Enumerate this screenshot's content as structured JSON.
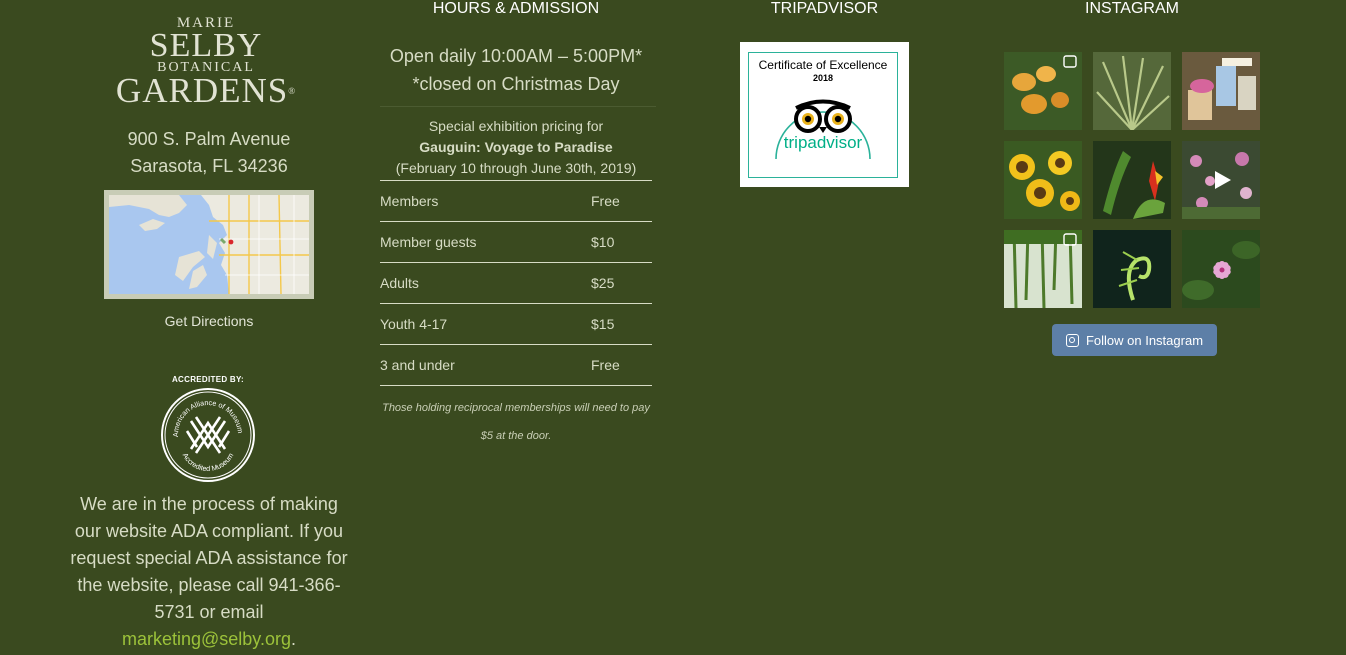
{
  "logo": {
    "line1": "MARIE",
    "line2": "SELBY",
    "line3": "BOTANICAL",
    "line4": "GARDENS",
    "reg": "®"
  },
  "address": {
    "street": "900 S. Palm Avenue",
    "city": "Sarasota, FL 34236"
  },
  "directions_label": "Get Directions",
  "accreditation": {
    "label": "ACCREDITED BY:",
    "seal_top": "American Alliance of Museums",
    "seal_bottom": "Accredited Museum"
  },
  "ada": {
    "text": "We are in the process of making our website ADA compliant. If you request special ADA assistance for the website, please call 941-366-5731 or email",
    "email": "marketing@selby.org",
    "end": "."
  },
  "hours": {
    "title": "HOURS & ADMISSION",
    "line1": "Open daily 10:00AM – 5:00PM*",
    "line2": "*closed on Christmas Day",
    "special_intro": "Special exhibition pricing for",
    "exhibition": "Gauguin: Voyage to Paradise",
    "dates": "(February 10 through June 30th, 2019)",
    "prices": [
      {
        "label": "Members",
        "value": "Free"
      },
      {
        "label": "Member guests",
        "value": "$10"
      },
      {
        "label": "Adults",
        "value": "$25"
      },
      {
        "label": "Youth 4-17",
        "value": "$15"
      },
      {
        "label": "3 and under",
        "value": "Free"
      }
    ],
    "note": "Those holding reciprocal memberships will need to pay $5 at the door."
  },
  "tripadvisor": {
    "title": "TRIPADVISOR",
    "cert_title": "Certificate of Excellence",
    "cert_year": "2018",
    "brand": "tripadvisor"
  },
  "instagram": {
    "title": "INSTAGRAM",
    "follow_label": "Follow on Instagram"
  },
  "colors": {
    "background": "#3a4a1f",
    "text": "#d7dcc5",
    "link": "#9cc23a",
    "button": "#5d7fa7",
    "tripadvisor_green": "#2bb29a"
  }
}
